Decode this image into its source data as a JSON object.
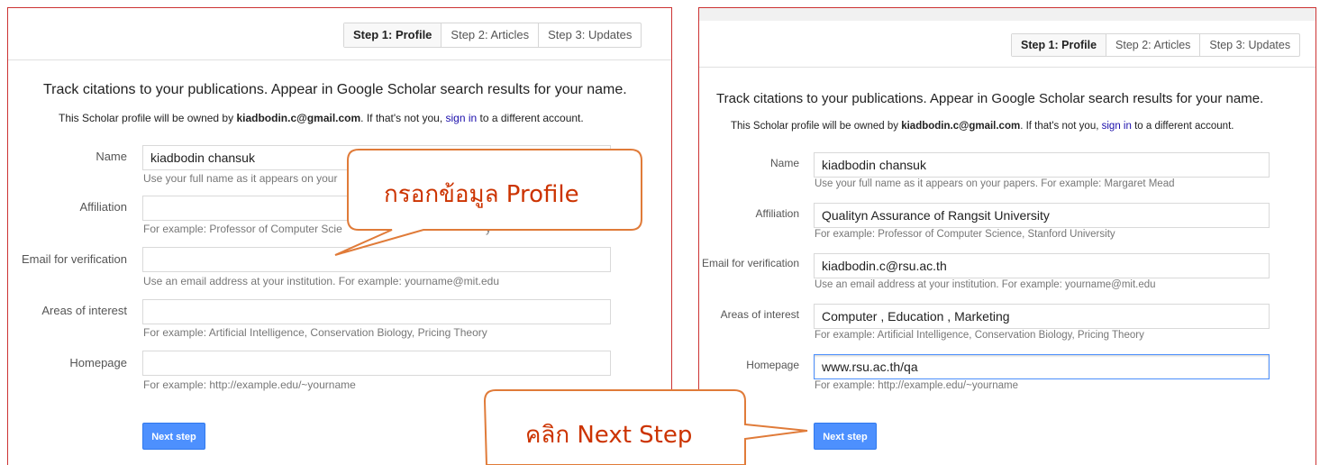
{
  "steps": [
    "Step 1: Profile",
    "Step 2: Articles",
    "Step 3: Updates"
  ],
  "headline": "Track citations to your publications. Appear in Google Scholar search results for your name.",
  "owner": {
    "prefix": "This Scholar profile will be owned by ",
    "email": "kiadbodin.c@gmail.com",
    "middle": ". If that's not you, ",
    "link": "sign in",
    "suffix": " to a different account."
  },
  "labels": {
    "name": "Name",
    "affiliation": "Affiliation",
    "email": "Email for verification",
    "interests": "Areas of interest",
    "homepage": "Homepage"
  },
  "hints": {
    "name_left": "Use your full name as it appears on your",
    "name": "Use your full name as it appears on your papers. For example: Margaret Mead",
    "affiliation_left": "For example: Professor of Computer Scie",
    "affiliation_left_tail": "y",
    "affiliation": "For example: Professor of Computer Science, Stanford University",
    "email": "Use an email address at your institution. For example: yourname@mit.edu",
    "interests": "For example: Artificial Intelligence, Conservation Biology, Pricing Theory",
    "homepage": "For example: http://example.edu/~yourname"
  },
  "left_values": {
    "name": "kiadbodin chansuk",
    "affiliation": "",
    "email": "",
    "interests": "",
    "homepage": ""
  },
  "right_values": {
    "name": "kiadbodin chansuk",
    "affiliation": "Qualityn Assurance of Rangsit University",
    "email": "kiadbodin.c@rsu.ac.th",
    "interests": "Computer , Education , Marketing",
    "homepage": "www.rsu.ac.th/qa"
  },
  "next_button": "Next step",
  "callouts": {
    "profile": "กรอกข้อมูล Profile",
    "next": "คลิก Next Step"
  },
  "colors": {
    "panel_border": "#cc3333",
    "callout_stroke": "#e07b39",
    "callout_text": "#cc3300",
    "button": "#4d90fe",
    "link": "#1a0dab"
  }
}
